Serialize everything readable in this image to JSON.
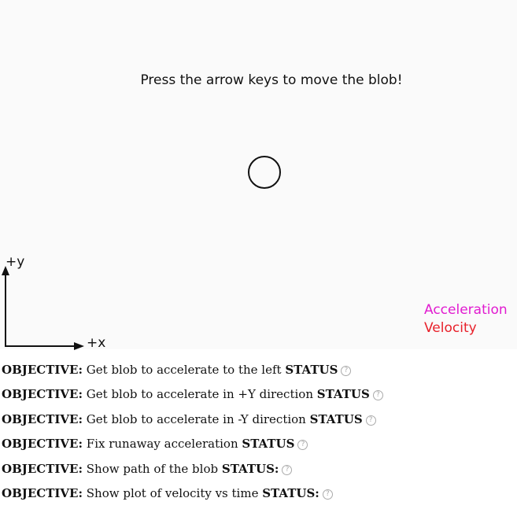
{
  "game": {
    "instruction": "Press the arrow keys to move the blob!",
    "axes": {
      "y_label": "+y",
      "x_label": "+x"
    },
    "legend": {
      "acceleration": "Acceleration",
      "velocity": "Velocity"
    },
    "colors": {
      "acceleration": "#e11bd0",
      "velocity": "#e8202a"
    }
  },
  "objectives": [
    {
      "prefix": "OBJECTIVE:",
      "text": " Get blob to accelerate to the left ",
      "status": "STATUS",
      "help_icon": "question-circle-icon"
    },
    {
      "prefix": "OBJECTIVE:",
      "text": " Get blob to accelerate in +Y direction ",
      "status": "STATUS",
      "help_icon": "question-circle-icon"
    },
    {
      "prefix": "OBJECTIVE:",
      "text": " Get blob to accelerate in -Y direction ",
      "status": "STATUS",
      "help_icon": "question-circle-icon"
    },
    {
      "prefix": "OBJECTIVE:",
      "text": " Fix runaway acceleration ",
      "status": "STATUS",
      "help_icon": "question-circle-icon"
    },
    {
      "prefix": "OBJECTIVE:",
      "text": " Show path of the blob ",
      "status": "STATUS:",
      "help_icon": "question-circle-icon"
    },
    {
      "prefix": "OBJECTIVE:",
      "text": " Show plot of velocity vs time ",
      "status": "STATUS:",
      "help_icon": "question-circle-icon"
    }
  ]
}
